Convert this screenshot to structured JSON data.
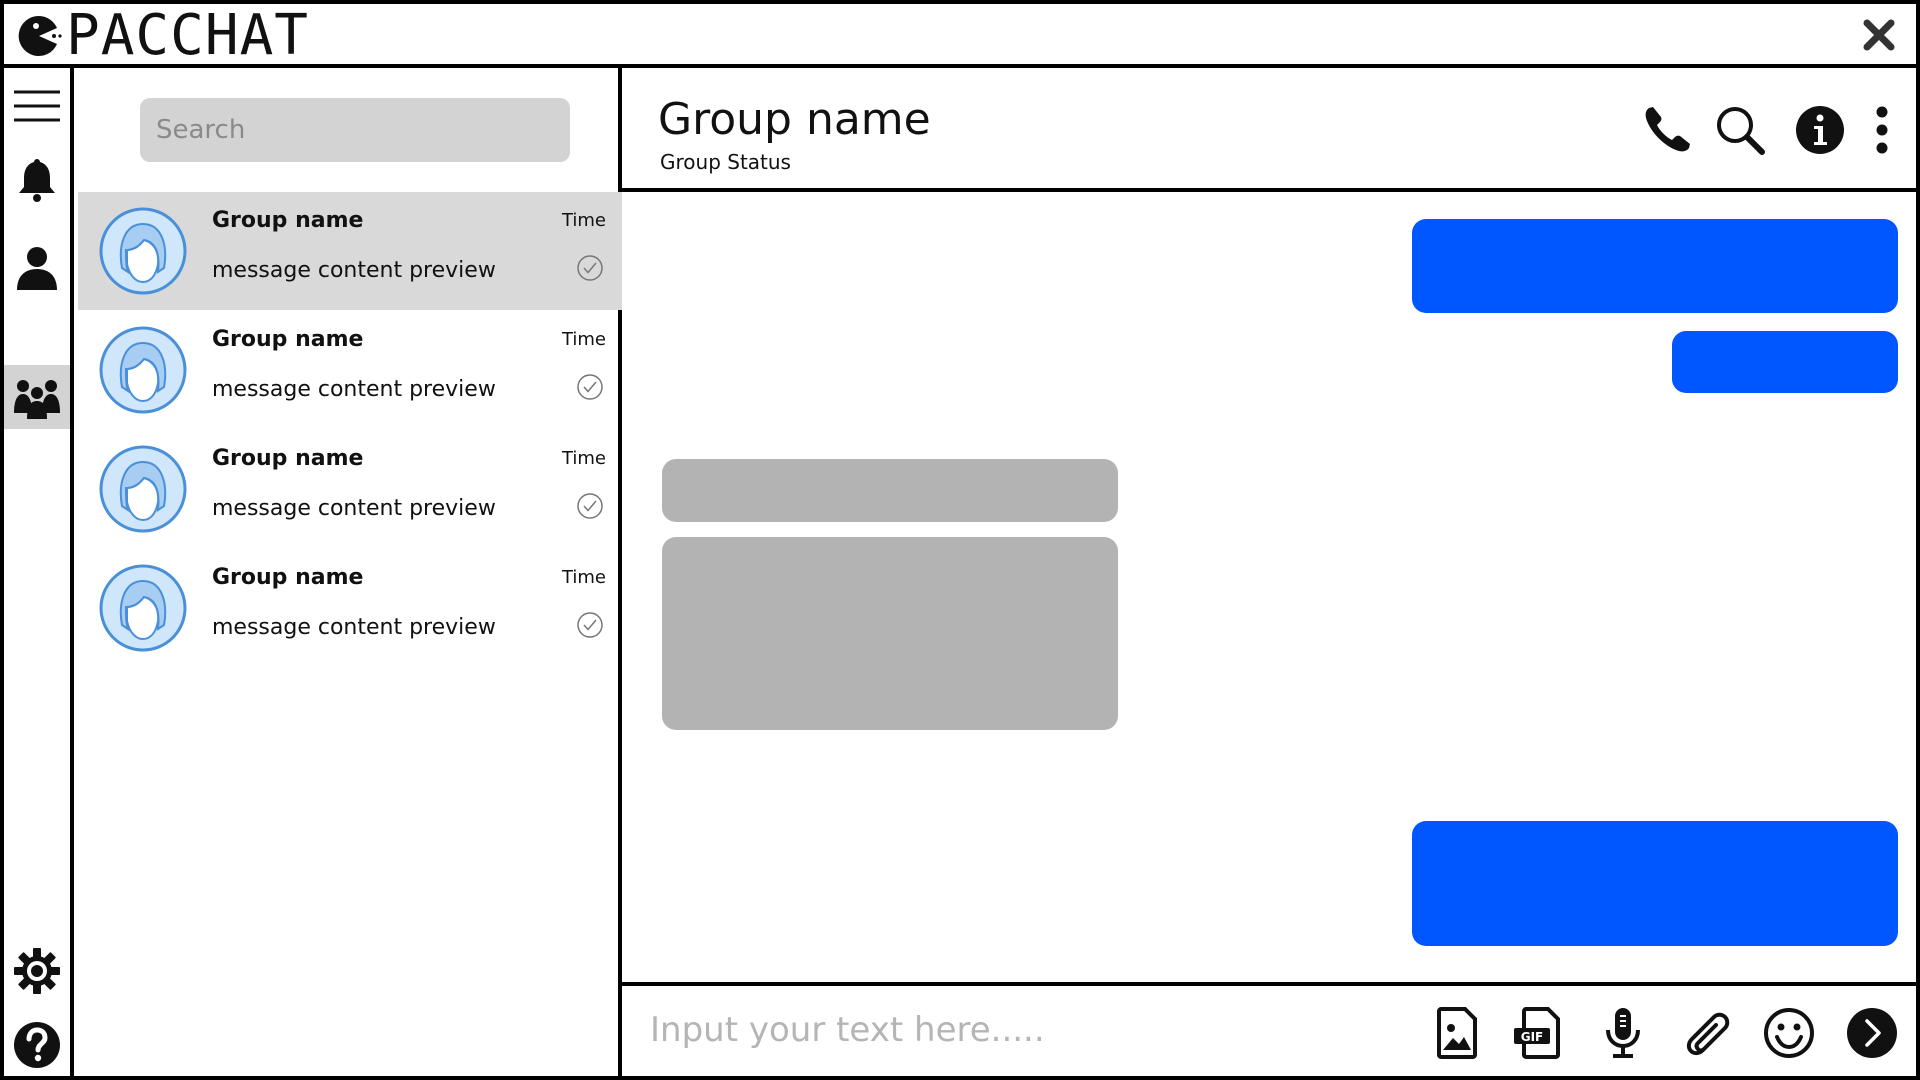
{
  "app": {
    "title": "PACCHAT"
  },
  "search": {
    "placeholder": "Search"
  },
  "chats": [
    {
      "name": "Group name",
      "time": "Time",
      "preview": "message content preview"
    },
    {
      "name": "Group name",
      "time": "Time",
      "preview": "message content preview"
    },
    {
      "name": "Group name",
      "time": "Time",
      "preview": "message content preview"
    },
    {
      "name": "Group name",
      "time": "Time",
      "preview": "message content preview"
    }
  ],
  "conversation": {
    "title": "Group name",
    "status": "Group Status"
  },
  "composer": {
    "placeholder": "Input your text here....."
  },
  "colors": {
    "outgoing": "#0057ff",
    "incoming": "#b3b3b3",
    "active_row": "#d9d9d9",
    "avatar": "#cfe6fb"
  },
  "icons": {
    "rail": [
      "menu-icon",
      "bell-icon",
      "user-icon",
      "group-icon",
      "gear-icon",
      "help-icon"
    ],
    "header": [
      "phone-icon",
      "search-icon",
      "info-icon",
      "more-vertical-icon"
    ],
    "composer": [
      "image-file-icon",
      "gif-file-icon",
      "microphone-icon",
      "paperclip-icon",
      "emoji-icon",
      "send-icon"
    ]
  }
}
